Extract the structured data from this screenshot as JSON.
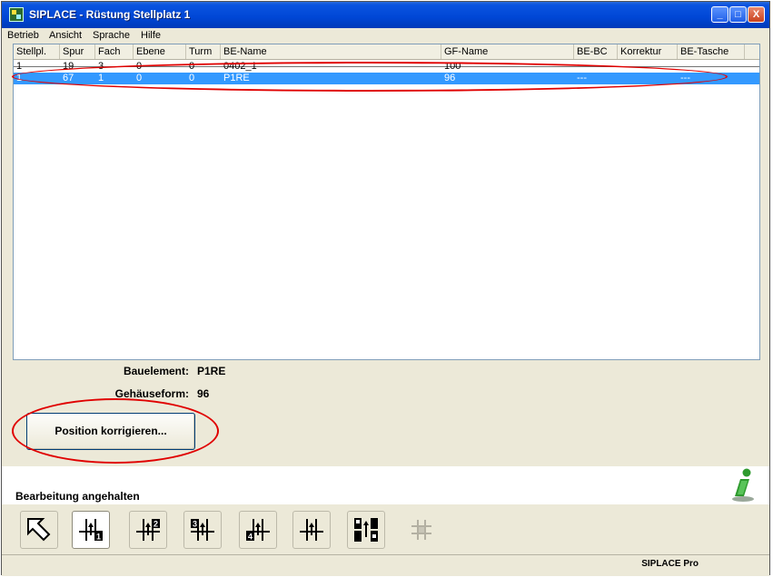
{
  "window": {
    "title": "SIPLACE - Rüstung Stellplatz 1",
    "controls": {
      "minimize": "_",
      "maximize": "□",
      "close": "X"
    }
  },
  "menu": [
    "Betrieb",
    "Ansicht",
    "Sprache",
    "Hilfe"
  ],
  "table": {
    "columns": [
      "Stellpl.",
      "Spur",
      "Fach",
      "Ebene",
      "Turm",
      "BE-Name",
      "GF-Name",
      "BE-BC",
      "Korrektur",
      "BE-Tasche"
    ],
    "rows": [
      {
        "stellpl": "1",
        "spur": "19",
        "fach": "3",
        "ebene": "0",
        "turm": "0",
        "be_name": "0402_1",
        "gf_name": "100",
        "be_bc": "",
        "korrektur": "",
        "be_tasche": ""
      },
      {
        "stellpl": "1",
        "spur": "67",
        "fach": "1",
        "ebene": "0",
        "turm": "0",
        "be_name": "P1RE",
        "gf_name": "96",
        "be_bc": "---",
        "korrektur": "",
        "be_tasche": "---"
      }
    ],
    "selected_row_index": 1
  },
  "details": {
    "bauelement_label": "Bauelement:",
    "bauelement_value": "P1RE",
    "gehaeuse_label": "Gehäuseform:",
    "gehaeuse_value": "96",
    "correct_button": "Position korrigieren..."
  },
  "status": {
    "text": "Bearbeitung angehalten"
  },
  "toolbar": {
    "buttons": [
      {
        "icon": "cursor-arrow-icon"
      },
      {
        "icon": "feeder-track-1-icon",
        "digit": "1"
      },
      {
        "icon": "feeder-track-2-icon",
        "digit": "2"
      },
      {
        "icon": "feeder-track-3-icon",
        "digit": "3"
      },
      {
        "icon": "feeder-track-4-icon",
        "digit": "4"
      },
      {
        "icon": "feeder-track-icon"
      },
      {
        "icon": "feeder-double-track-icon"
      },
      {
        "icon": "pcb-grid-icon-disabled"
      }
    ]
  },
  "footer": {
    "brand": "SIPLACE Pro"
  },
  "colors": {
    "titlebar": "#0046d5",
    "selection": "#3399ff",
    "annotation": "#e00000",
    "window_bg": "#ece9d8"
  }
}
